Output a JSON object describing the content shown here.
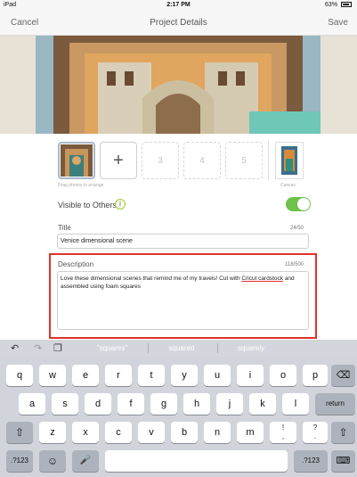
{
  "status_bar": {
    "carrier": "iPad",
    "time": "2:17 PM",
    "battery": "63%"
  },
  "nav": {
    "cancel": "Cancel",
    "title": "Project Details",
    "save": "Save"
  },
  "thumbnails": {
    "slots": [
      "3",
      "4",
      "5"
    ],
    "add_label": "+",
    "hint": "Drag photos to arrange",
    "canvas_label": "Canvas"
  },
  "visibility": {
    "label": "Visible to Others",
    "info_icon": "i",
    "enabled": true
  },
  "title_field": {
    "label": "Title",
    "count": "24/50",
    "value": "Venice dimensional scene"
  },
  "description_field": {
    "label": "Description",
    "count": "118/500",
    "text_before": "Love these dimensional scenes that remind me of my travels! Cut with ",
    "text_underlined": "Cricut cardstock",
    "text_after": " and assembled using foam squares"
  },
  "keyboard_toolbar": {
    "undo_icon": "undo-icon",
    "redo_icon": "redo-icon",
    "paste_icon": "paste-icon",
    "suggestions": [
      "\"squares\"",
      "squared",
      "squarely"
    ]
  },
  "keyboard": {
    "row1": [
      "q",
      "w",
      "e",
      "r",
      "t",
      "y",
      "u",
      "i",
      "o",
      "p"
    ],
    "row1_end": "⌫",
    "row2": [
      "a",
      "s",
      "d",
      "f",
      "g",
      "h",
      "j",
      "k",
      "l"
    ],
    "row2_end": "return",
    "row3": [
      "z",
      "x",
      "c",
      "v",
      "b",
      "n",
      "m",
      "!\n,",
      "?\n."
    ],
    "shift": "⇧",
    "row4": {
      "numbers": ".?123",
      "emoji": "☺",
      "mic": "🎤",
      "space": "",
      "numbers_right": ".?123",
      "hide": "⌨"
    }
  }
}
